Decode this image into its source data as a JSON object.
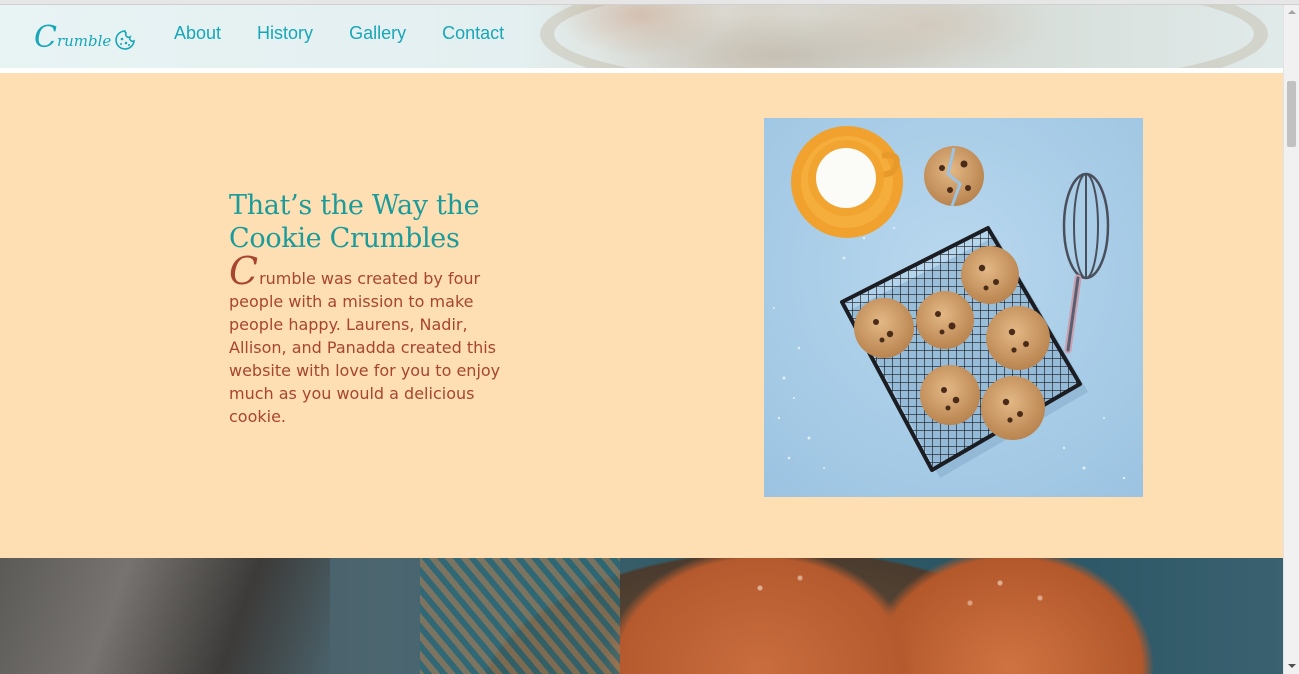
{
  "brand": {
    "logo_initial": "C",
    "logo_rest": "rumble",
    "logo_icon": "cookie-icon",
    "accent_color": "#17a7b8"
  },
  "nav": {
    "items": [
      {
        "label": "About"
      },
      {
        "label": "History"
      },
      {
        "label": "Gallery"
      },
      {
        "label": "Contact"
      }
    ]
  },
  "intro": {
    "heading": "That’s the Way the Cookie Crumbles",
    "dropcap": "C",
    "body": "rumble was created by four people with a mission to make people happy. Laurens, Nadir, Allison, and Panadda created this website with love for you to enjoy much as you would a delicious cookie.",
    "heading_color": "#1c9b9b",
    "text_color": "#a8452e",
    "background_color": "#fddfb3"
  },
  "images": {
    "feature_photo": "cookies-on-cooling-rack-photo",
    "banner_photo": "cookies-on-tray-photo"
  },
  "scrollbar": {
    "up_icon": "triangle-up-icon",
    "down_icon": "triangle-down-icon"
  }
}
